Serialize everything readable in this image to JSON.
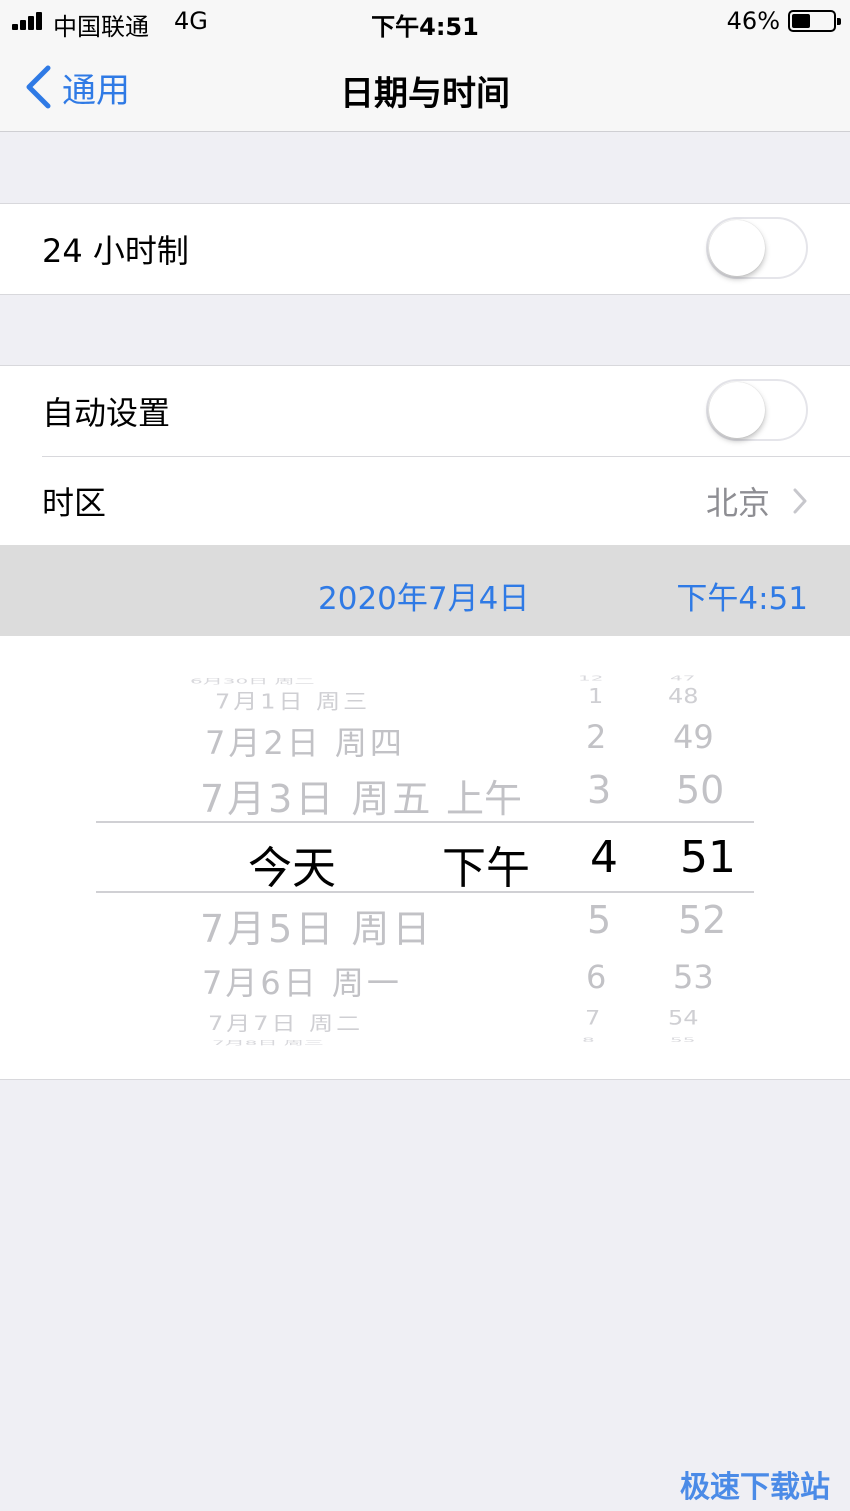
{
  "status": {
    "carrier": "中国联通",
    "network": "4G",
    "time": "下午4:51",
    "battery_percent": "46%",
    "battery_level": 0.46
  },
  "nav": {
    "back_label": "通用",
    "title": "日期与时间"
  },
  "settings": {
    "hour24": {
      "label": "24 小时制",
      "on": false
    },
    "auto_set": {
      "label": "自动设置",
      "on": false
    },
    "timezone": {
      "label": "时区",
      "value": "北京"
    }
  },
  "summary": {
    "date": "2020年7月4日",
    "time": "下午4:51"
  },
  "picker": {
    "dates": [
      "6月30日 周二",
      "7月1日 周三",
      "7月2日 周四",
      "7月3日 周五",
      "今天",
      "7月5日 周日",
      "7月6日 周一",
      "7月7日 周二",
      "7月8日 周三"
    ],
    "ampm": [
      "上午",
      "下午"
    ],
    "hours": [
      "12",
      "1",
      "2",
      "3",
      "4",
      "5",
      "6",
      "7",
      "8"
    ],
    "minutes": [
      "47",
      "48",
      "49",
      "50",
      "51",
      "52",
      "53",
      "54",
      "55"
    ]
  },
  "watermark": "极速下载站",
  "colors": {
    "accent": "#2f7ae5",
    "secondary": "#8e8e93"
  }
}
